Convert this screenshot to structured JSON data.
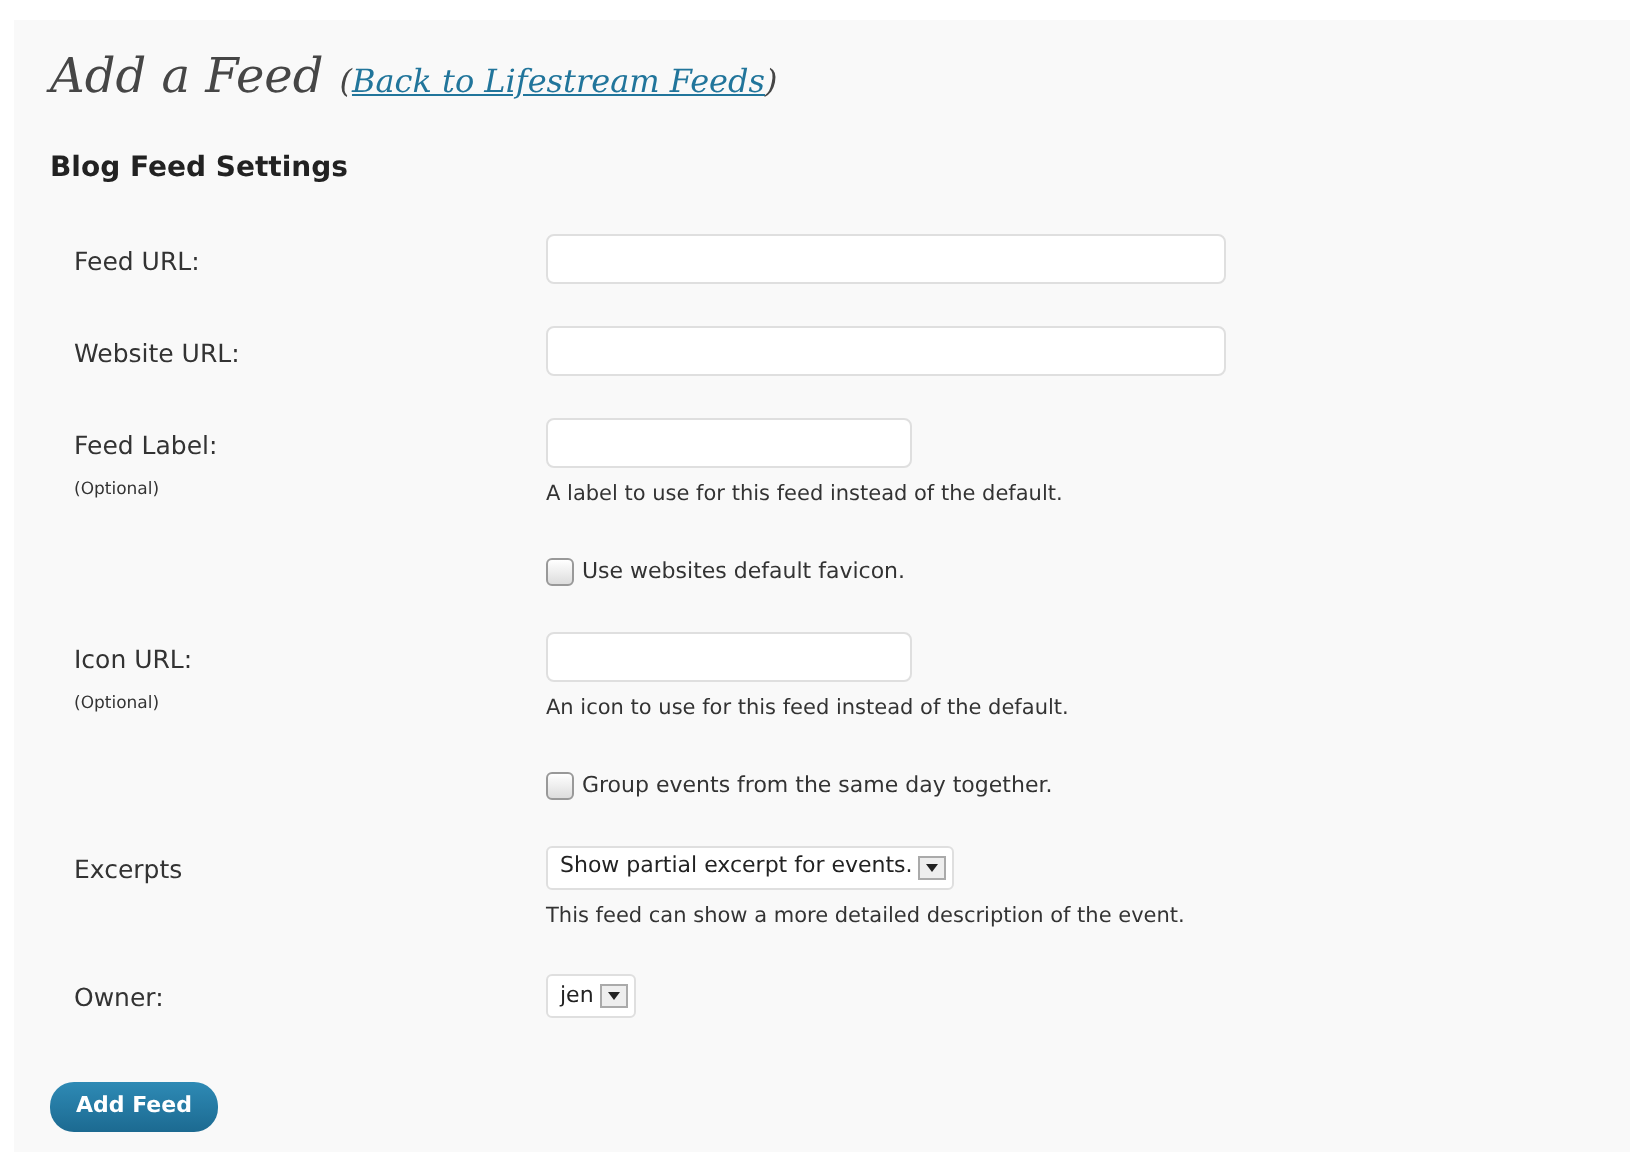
{
  "heading": {
    "title": "Add a Feed",
    "back_link": {
      "before": "(",
      "label": "Back to Lifestream Feeds",
      "after": ")"
    }
  },
  "section_title": "Blog Feed Settings",
  "rows": [
    {
      "kind": "url",
      "label": "Feed URL:"
    },
    {
      "kind": "url",
      "label": "Website URL:"
    },
    {
      "kind": "text",
      "label": "Feed Label:",
      "note": "(Optional)",
      "hint": "A label to use for this feed instead of the default."
    },
    {
      "kind": "checkbox",
      "label": "Use websites default favicon.",
      "checked": false
    },
    {
      "kind": "text",
      "label": "Icon URL:",
      "note": "(Optional)",
      "hint": "An icon to use for this feed instead of the default."
    },
    {
      "kind": "checkbox",
      "label": "Group events from the same day together.",
      "checked": false
    },
    {
      "kind": "select",
      "label": "Excerpts",
      "value": "Show partial excerpt for events.",
      "hint": "This feed can show a more detailed description of the event."
    },
    {
      "kind": "select",
      "label": "Owner:",
      "value": "jen"
    }
  ],
  "submit_button": "Add Feed"
}
